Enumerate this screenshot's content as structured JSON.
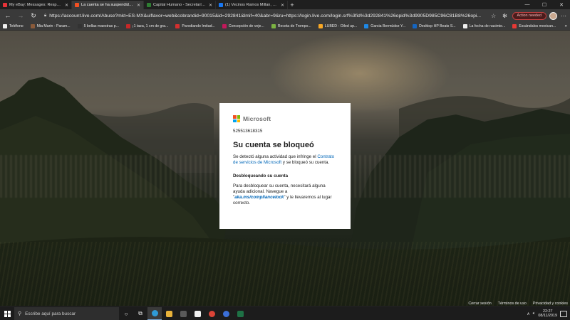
{
  "browser": {
    "tabs": [
      {
        "title": "My eBay: Messages: Response T",
        "favicon_color": "#e53238",
        "active": false
      },
      {
        "title": "La cuenta se ha suspendido tem",
        "favicon_color": "#f25022",
        "active": true
      },
      {
        "title": "Capital Humano - Secretaría de",
        "favicon_color": "#2e7d32",
        "active": false
      },
      {
        "title": "(1) Vecinos Ramos Millan, Tlacot",
        "favicon_color": "#1877f2",
        "active": false
      }
    ],
    "new_tab_label": "+",
    "window_controls": {
      "minimize": "—",
      "maximize": "☐",
      "close": "✕"
    },
    "url": "https://account.live.com/Abuse?mkt=ES-MX&uiflavor=web&cobrandid=90015&id=292841&lmif=40&abr=9&ru=https://login.live.com/login.srf%3fid%3d292841%26opid%3d9905D985C96C81B8%26opi...",
    "action_needed_label": "Action needed"
  },
  "bookmarks": [
    {
      "label": "Teléfono",
      "color": "#f0f0f0"
    },
    {
      "label": "Mia Marin - Param...",
      "color": "#8a5a3a"
    },
    {
      "label": "5 bellas maestras p...",
      "color": "#333333"
    },
    {
      "label": "¡1 taza, 1 cm de gra...",
      "color": "#c62828"
    },
    {
      "label": "Parodiando Imitad...",
      "color": "#d32f2f"
    },
    {
      "label": "Concepción de veje...",
      "color": "#c2185b"
    },
    {
      "label": "Receta de Trompo...",
      "color": "#7cb342"
    },
    {
      "label": "LUBED - Oiled up...",
      "color": "#f9a825"
    },
    {
      "label": "Garcia Bermúdez Y...",
      "color": "#1e88e5"
    },
    {
      "label": "Desktop HP Beats S...",
      "color": "#1565c0"
    },
    {
      "label": "La fecha de nacimie...",
      "color": "#eeeeee"
    },
    {
      "label": "Escándalos mexican...",
      "color": "#e53935"
    }
  ],
  "card": {
    "brand": "Microsoft",
    "brand_colors": [
      "#f25022",
      "#7fba00",
      "#00a4ef",
      "#ffb900"
    ],
    "identity": "525513618315",
    "heading": "Su cuenta se bloqueó",
    "intro_before": "Se detectó alguna actividad que infringe el ",
    "intro_link": "Contrato de servicios de Microsoft",
    "intro_after": " y se bloqueó su cuenta.",
    "subheading": "Desbloqueando su cuenta",
    "body_before": "Para desbloquear su cuenta, necesitará alguna ayuda adicional. Navegue a \"",
    "body_link": "aka.ms/compliancelock",
    "body_after": "\" y le llevaremos al lugar correcto."
  },
  "footer": {
    "sign_out": "Cerrar sesión",
    "terms": "Términos de uso",
    "privacy": "Privacidad y cookies"
  },
  "taskbar": {
    "search_placeholder": "Escribe aquí para buscar",
    "time": "22:27",
    "date": "08/11/2019"
  }
}
